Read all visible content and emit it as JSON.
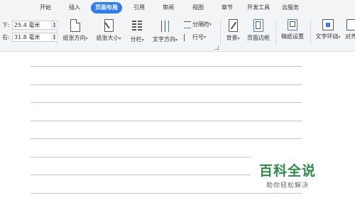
{
  "tabs": [
    {
      "label": "开始"
    },
    {
      "label": "插入"
    },
    {
      "label": "页面布局",
      "active": true
    },
    {
      "label": "引用"
    },
    {
      "label": "审阅"
    },
    {
      "label": "视图"
    },
    {
      "label": "章节"
    },
    {
      "label": "开发工具"
    },
    {
      "label": "云服务"
    }
  ],
  "margins": {
    "bottom_label": "下:",
    "bottom_value": "25.4 毫米",
    "right_label": "右:",
    "right_value": "31.8 毫米"
  },
  "toolbar": {
    "orientation": "纸张方向",
    "size": "纸张大小",
    "columns": "分栏",
    "text_direction": "文字方向",
    "separator": "分隔符",
    "line_numbers": "行号",
    "background": "背景",
    "page_border": "页面边框",
    "draft_setup": "稿纸设置",
    "text_wrap": "文字环绕",
    "align": "对齐"
  },
  "watermark": {
    "title": "百科全说",
    "subtitle": "助你轻松解决"
  },
  "colors": {
    "accent": "#2e7cf5",
    "watermark_green": "#2e8b4a"
  }
}
